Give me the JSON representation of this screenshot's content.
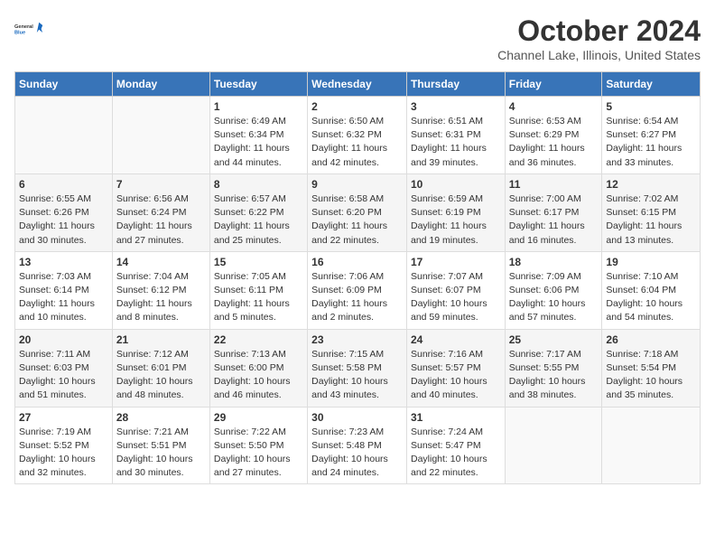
{
  "logo": {
    "text_general": "General",
    "text_blue": "Blue"
  },
  "header": {
    "month": "October 2024",
    "location": "Channel Lake, Illinois, United States"
  },
  "weekdays": [
    "Sunday",
    "Monday",
    "Tuesday",
    "Wednesday",
    "Thursday",
    "Friday",
    "Saturday"
  ],
  "weeks": [
    [
      null,
      null,
      {
        "day": "1",
        "sunrise": "6:49 AM",
        "sunset": "6:34 PM",
        "daylight": "11 hours and 44 minutes."
      },
      {
        "day": "2",
        "sunrise": "6:50 AM",
        "sunset": "6:32 PM",
        "daylight": "11 hours and 42 minutes."
      },
      {
        "day": "3",
        "sunrise": "6:51 AM",
        "sunset": "6:31 PM",
        "daylight": "11 hours and 39 minutes."
      },
      {
        "day": "4",
        "sunrise": "6:53 AM",
        "sunset": "6:29 PM",
        "daylight": "11 hours and 36 minutes."
      },
      {
        "day": "5",
        "sunrise": "6:54 AM",
        "sunset": "6:27 PM",
        "daylight": "11 hours and 33 minutes."
      }
    ],
    [
      {
        "day": "6",
        "sunrise": "6:55 AM",
        "sunset": "6:26 PM",
        "daylight": "11 hours and 30 minutes."
      },
      {
        "day": "7",
        "sunrise": "6:56 AM",
        "sunset": "6:24 PM",
        "daylight": "11 hours and 27 minutes."
      },
      {
        "day": "8",
        "sunrise": "6:57 AM",
        "sunset": "6:22 PM",
        "daylight": "11 hours and 25 minutes."
      },
      {
        "day": "9",
        "sunrise": "6:58 AM",
        "sunset": "6:20 PM",
        "daylight": "11 hours and 22 minutes."
      },
      {
        "day": "10",
        "sunrise": "6:59 AM",
        "sunset": "6:19 PM",
        "daylight": "11 hours and 19 minutes."
      },
      {
        "day": "11",
        "sunrise": "7:00 AM",
        "sunset": "6:17 PM",
        "daylight": "11 hours and 16 minutes."
      },
      {
        "day": "12",
        "sunrise": "7:02 AM",
        "sunset": "6:15 PM",
        "daylight": "11 hours and 13 minutes."
      }
    ],
    [
      {
        "day": "13",
        "sunrise": "7:03 AM",
        "sunset": "6:14 PM",
        "daylight": "11 hours and 10 minutes."
      },
      {
        "day": "14",
        "sunrise": "7:04 AM",
        "sunset": "6:12 PM",
        "daylight": "11 hours and 8 minutes."
      },
      {
        "day": "15",
        "sunrise": "7:05 AM",
        "sunset": "6:11 PM",
        "daylight": "11 hours and 5 minutes."
      },
      {
        "day": "16",
        "sunrise": "7:06 AM",
        "sunset": "6:09 PM",
        "daylight": "11 hours and 2 minutes."
      },
      {
        "day": "17",
        "sunrise": "7:07 AM",
        "sunset": "6:07 PM",
        "daylight": "10 hours and 59 minutes."
      },
      {
        "day": "18",
        "sunrise": "7:09 AM",
        "sunset": "6:06 PM",
        "daylight": "10 hours and 57 minutes."
      },
      {
        "day": "19",
        "sunrise": "7:10 AM",
        "sunset": "6:04 PM",
        "daylight": "10 hours and 54 minutes."
      }
    ],
    [
      {
        "day": "20",
        "sunrise": "7:11 AM",
        "sunset": "6:03 PM",
        "daylight": "10 hours and 51 minutes."
      },
      {
        "day": "21",
        "sunrise": "7:12 AM",
        "sunset": "6:01 PM",
        "daylight": "10 hours and 48 minutes."
      },
      {
        "day": "22",
        "sunrise": "7:13 AM",
        "sunset": "6:00 PM",
        "daylight": "10 hours and 46 minutes."
      },
      {
        "day": "23",
        "sunrise": "7:15 AM",
        "sunset": "5:58 PM",
        "daylight": "10 hours and 43 minutes."
      },
      {
        "day": "24",
        "sunrise": "7:16 AM",
        "sunset": "5:57 PM",
        "daylight": "10 hours and 40 minutes."
      },
      {
        "day": "25",
        "sunrise": "7:17 AM",
        "sunset": "5:55 PM",
        "daylight": "10 hours and 38 minutes."
      },
      {
        "day": "26",
        "sunrise": "7:18 AM",
        "sunset": "5:54 PM",
        "daylight": "10 hours and 35 minutes."
      }
    ],
    [
      {
        "day": "27",
        "sunrise": "7:19 AM",
        "sunset": "5:52 PM",
        "daylight": "10 hours and 32 minutes."
      },
      {
        "day": "28",
        "sunrise": "7:21 AM",
        "sunset": "5:51 PM",
        "daylight": "10 hours and 30 minutes."
      },
      {
        "day": "29",
        "sunrise": "7:22 AM",
        "sunset": "5:50 PM",
        "daylight": "10 hours and 27 minutes."
      },
      {
        "day": "30",
        "sunrise": "7:23 AM",
        "sunset": "5:48 PM",
        "daylight": "10 hours and 24 minutes."
      },
      {
        "day": "31",
        "sunrise": "7:24 AM",
        "sunset": "5:47 PM",
        "daylight": "10 hours and 22 minutes."
      },
      null,
      null
    ]
  ],
  "labels": {
    "sunrise": "Sunrise:",
    "sunset": "Sunset:",
    "daylight": "Daylight:"
  }
}
